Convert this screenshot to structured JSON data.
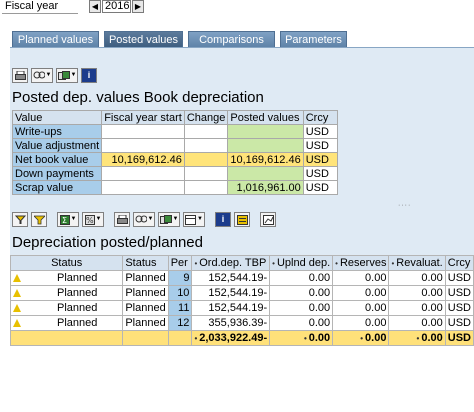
{
  "header": {
    "fiscal_year_label": "Fiscal year",
    "fiscal_year_value": "2016"
  },
  "tabs": [
    {
      "label": "Planned values",
      "active": false
    },
    {
      "label": "Posted values",
      "active": true
    },
    {
      "label": "Comparisons",
      "active": false
    },
    {
      "label": "Parameters",
      "active": false
    }
  ],
  "toolbar1": {
    "icons": [
      "print-icon",
      "search-dropdown-icon",
      "export-dropdown-icon",
      "info-icon"
    ],
    "info_glyph": "i"
  },
  "posted_values": {
    "title": "Posted dep. values Book depreciation",
    "columns": [
      "Value",
      "Fiscal year start",
      "Change",
      "Posted values",
      "Crcy"
    ],
    "rows": [
      {
        "label": "Write-ups",
        "fy_start": "",
        "change": "",
        "posted": "",
        "crcy": "USD"
      },
      {
        "label": "Value adjustment",
        "fy_start": "",
        "change": "",
        "posted": "",
        "crcy": "USD"
      },
      {
        "label": "Net book value",
        "fy_start": "10,169,612.46",
        "change": "",
        "posted": "10,169,612.46",
        "crcy": "USD"
      },
      {
        "label": "Down payments",
        "fy_start": "",
        "change": "",
        "posted": "",
        "crcy": "USD"
      },
      {
        "label": "Scrap value",
        "fy_start": "",
        "change": "",
        "posted": "1,016,961.00",
        "crcy": "USD"
      }
    ]
  },
  "toolbar2": {
    "info_glyph": "i"
  },
  "depreciation": {
    "title": "Depreciation posted/planned",
    "columns": [
      "Status",
      "Status",
      "Per",
      "Ord.dep. TBP",
      "Uplnd dep.",
      "Reserves",
      "Revaluat.",
      "Crcy"
    ],
    "rows": [
      {
        "status_text": "Planned",
        "status": "Planned",
        "per": "9",
        "ord_dep": "152,544.19-",
        "uplnd": "0.00",
        "reserves": "0.00",
        "revaluat": "0.00",
        "crcy": "USD"
      },
      {
        "status_text": "Planned",
        "status": "Planned",
        "per": "10",
        "ord_dep": "152,544.19-",
        "uplnd": "0.00",
        "reserves": "0.00",
        "revaluat": "0.00",
        "crcy": "USD"
      },
      {
        "status_text": "Planned",
        "status": "Planned",
        "per": "11",
        "ord_dep": "152,544.19-",
        "uplnd": "0.00",
        "reserves": "0.00",
        "revaluat": "0.00",
        "crcy": "USD"
      },
      {
        "status_text": "Planned",
        "status": "Planned",
        "per": "12",
        "ord_dep": "355,936.39-",
        "uplnd": "0.00",
        "reserves": "0.00",
        "revaluat": "0.00",
        "crcy": "USD"
      }
    ],
    "total": {
      "ord_dep": "2,033,922.49-",
      "uplnd": "0.00",
      "reserves": "0.00",
      "revaluat": "0.00",
      "crcy": "USD"
    },
    "sum_marker": "•",
    "total_marker": "•"
  },
  "colors": {
    "tab_bg": "#5f83a8",
    "panel_bg": "#dfeaf4",
    "highlight_yellow": "#ffe47a",
    "posted_green": "#cbe8a7",
    "row_label_blue": "#a8cdea",
    "warning_triangle": "#e8c000"
  }
}
